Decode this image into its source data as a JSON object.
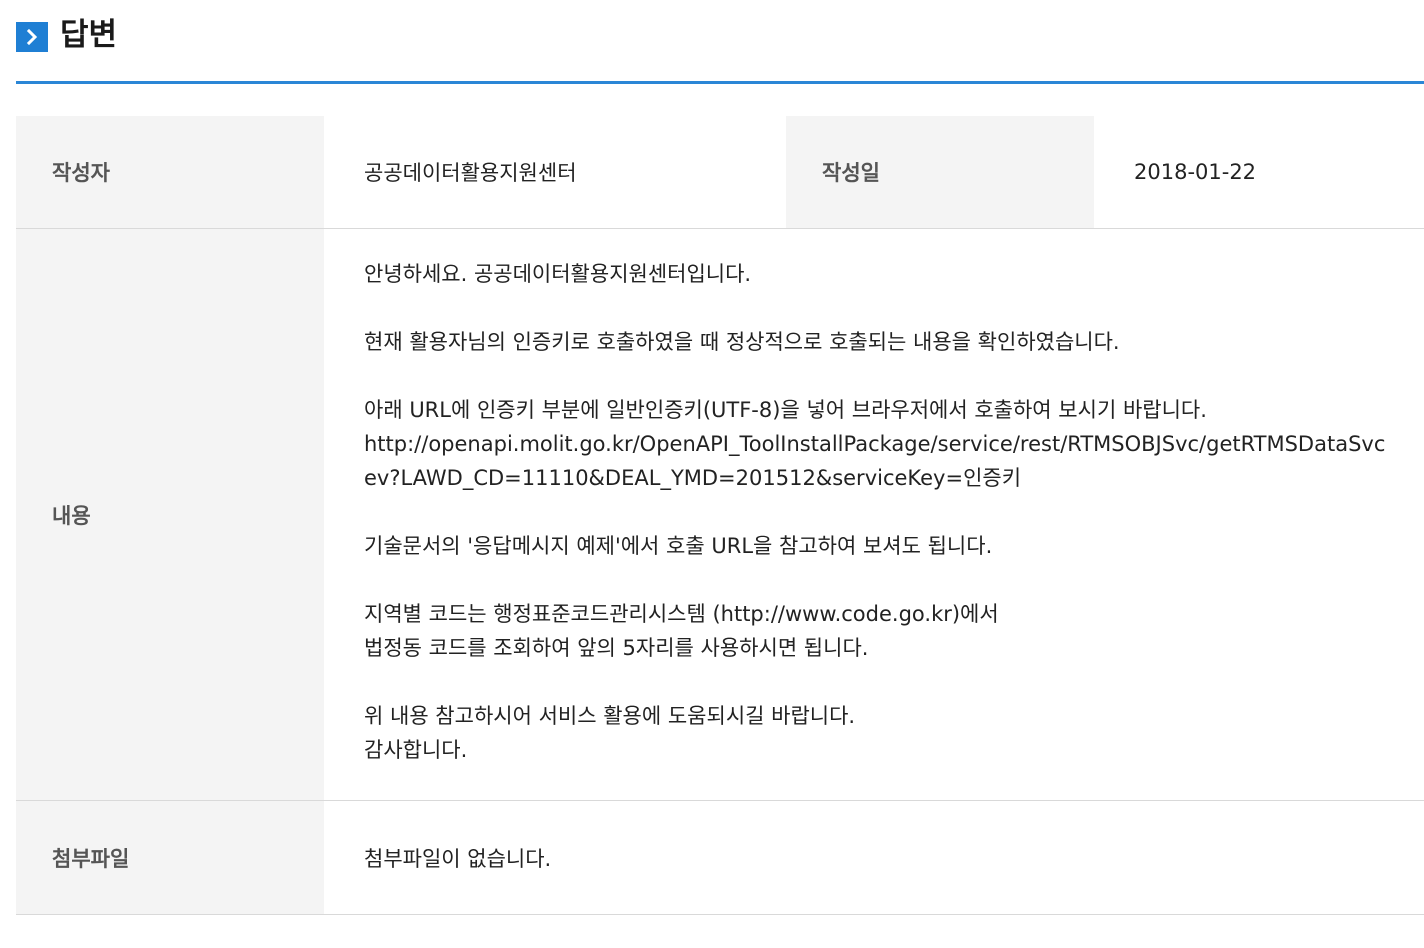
{
  "header": {
    "icon": "chevron-right-icon",
    "title": "답변",
    "accent_color": "#1f7fd4"
  },
  "table": {
    "author_label": "작성자",
    "author_value": "공공데이터활용지원센터",
    "date_label": "작성일",
    "date_value": "2018-01-22",
    "content_label": "내용",
    "content_lines": [
      "안녕하세요. 공공데이터활용지원센터입니다.",
      "",
      "현재 활용자님의 인증키로 호출하였을 때 정상적으로 호출되는 내용을 확인하였습니다.",
      "",
      "아래 URL에 인증키 부분에 일반인증키(UTF-8)을 넣어 브라우저에서 호출하여 보시기 바랍니다.",
      "http://openapi.molit.go.kr/OpenAPI_ToolInstallPackage/service/rest/RTMSOBJSvc/getRTMSDataSvc",
      "ev?LAWD_CD=11110&DEAL_YMD=201512&serviceKey=인증키",
      "",
      "기술문서의 '응답메시지 예제'에서 호출 URL을 참고하여 보셔도 됩니다.",
      "",
      "지역별 코드는 행정표준코드관리시스템 (http://www.code.go.kr)에서",
      "법정동 코드를 조회하여 앞의 5자리를 사용하시면 됩니다.",
      "",
      "위 내용 참고하시어 서비스 활용에 도움되시길 바랍니다.",
      "감사합니다."
    ],
    "attach_label": "첨부파일",
    "attach_value": "첨부파일이 없습니다."
  }
}
